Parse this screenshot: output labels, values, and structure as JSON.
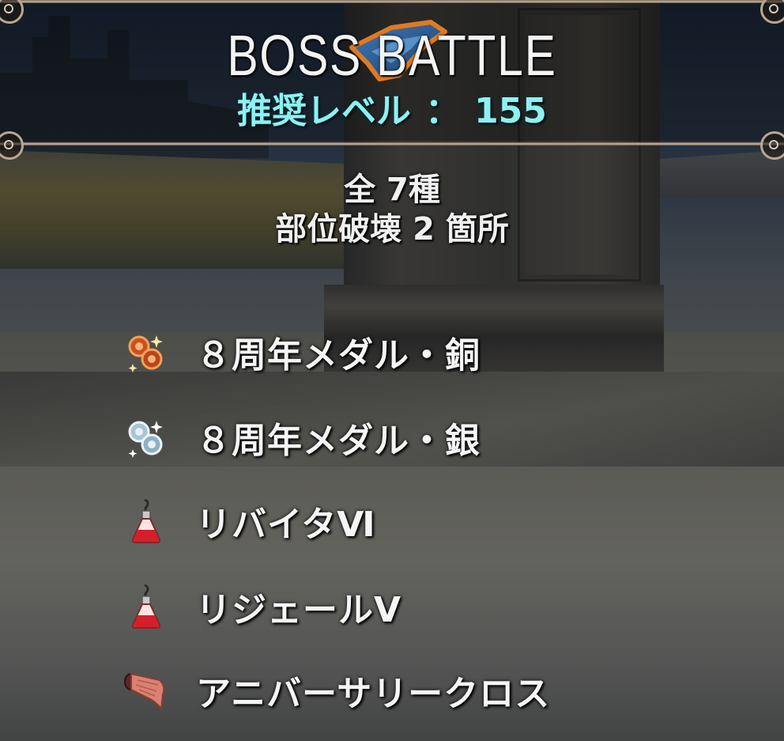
{
  "header": {
    "title": "BOSS  BATTLE",
    "recommended_level_label": "推奨レベル",
    "separator": "：",
    "recommended_level_value": "155"
  },
  "summary": {
    "total_types": "全 7種",
    "breakable_parts": "部位破壊 2 箇所"
  },
  "rewards": [
    {
      "label": "８周年メダル・銅",
      "icon": "bronze-medal-icon"
    },
    {
      "label": "８周年メダル・銀",
      "icon": "silver-medal-icon"
    },
    {
      "label": "リバイタⅥ",
      "icon": "red-potion-icon"
    },
    {
      "label": "リジェールⅤ",
      "icon": "red-potion-icon"
    },
    {
      "label": "アニバーサリークロス",
      "icon": "cloth-icon"
    }
  ],
  "colors": {
    "level_text": "#8ff0f2",
    "title_text": "#f3f3f3",
    "frame": "#c9b8a3"
  }
}
